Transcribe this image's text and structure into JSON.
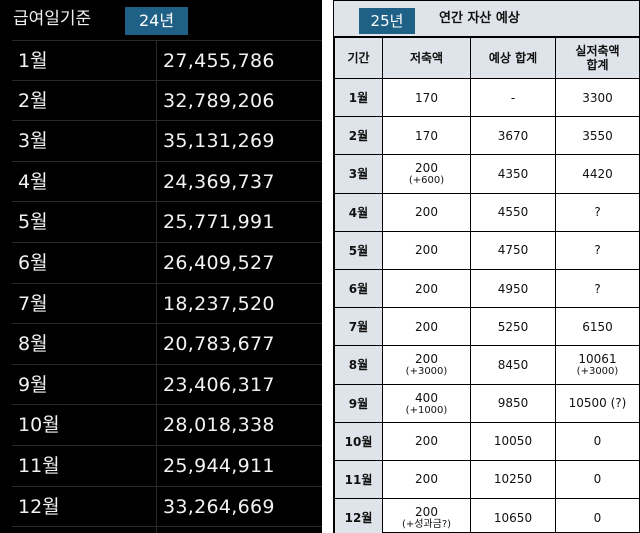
{
  "salary": {
    "title": "급여일기준",
    "year_tag": "24년",
    "rows": [
      {
        "month": "1월",
        "value": "27,455,786"
      },
      {
        "month": "2월",
        "value": "32,789,206"
      },
      {
        "month": "3월",
        "value": "35,131,269"
      },
      {
        "month": "4월",
        "value": "24,369,737"
      },
      {
        "month": "5월",
        "value": "25,771,991"
      },
      {
        "month": "6월",
        "value": "26,409,527"
      },
      {
        "month": "7월",
        "value": "18,237,520"
      },
      {
        "month": "8월",
        "value": "20,783,677"
      },
      {
        "month": "9월",
        "value": "23,406,317"
      },
      {
        "month": "10월",
        "value": "28,018,338"
      },
      {
        "month": "11월",
        "value": "25,944,911"
      },
      {
        "month": "12월",
        "value": "33,264,669"
      }
    ]
  },
  "forecast": {
    "year_tag": "25년",
    "title": "연간 자산 예상",
    "headers": [
      "기간",
      "저축액",
      "예상 합계",
      "실저축액\n합계"
    ],
    "rows": [
      {
        "month": "1월",
        "saving": "170",
        "saving_sub": "",
        "expected": "-",
        "actual": "3300",
        "actual_sub": ""
      },
      {
        "month": "2월",
        "saving": "170",
        "saving_sub": "",
        "expected": "3670",
        "actual": "3550",
        "actual_sub": ""
      },
      {
        "month": "3월",
        "saving": "200",
        "saving_sub": "(+600)",
        "expected": "4350",
        "actual": "4420",
        "actual_sub": ""
      },
      {
        "month": "4월",
        "saving": "200",
        "saving_sub": "",
        "expected": "4550",
        "actual": "?",
        "actual_sub": ""
      },
      {
        "month": "5월",
        "saving": "200",
        "saving_sub": "",
        "expected": "4750",
        "actual": "?",
        "actual_sub": ""
      },
      {
        "month": "6월",
        "saving": "200",
        "saving_sub": "",
        "expected": "4950",
        "actual": "?",
        "actual_sub": ""
      },
      {
        "month": "7월",
        "saving": "200",
        "saving_sub": "",
        "expected": "5250",
        "actual": "6150",
        "actual_sub": ""
      },
      {
        "month": "8월",
        "saving": "200",
        "saving_sub": "(+3000)",
        "expected": "8450",
        "actual": "10061",
        "actual_sub": "(+3000)"
      },
      {
        "month": "9월",
        "saving": "400",
        "saving_sub": "(+1000)",
        "expected": "9850",
        "actual": "10500 (?)",
        "actual_sub": ""
      },
      {
        "month": "10월",
        "saving": "200",
        "saving_sub": "",
        "expected": "10050",
        "actual": "0",
        "actual_sub": ""
      },
      {
        "month": "11월",
        "saving": "200",
        "saving_sub": "",
        "expected": "10250",
        "actual": "0",
        "actual_sub": ""
      },
      {
        "month": "12월",
        "saving": "200",
        "saving_sub": "(+성과금?)",
        "expected": "10650",
        "actual": "0",
        "actual_sub": ""
      }
    ]
  }
}
